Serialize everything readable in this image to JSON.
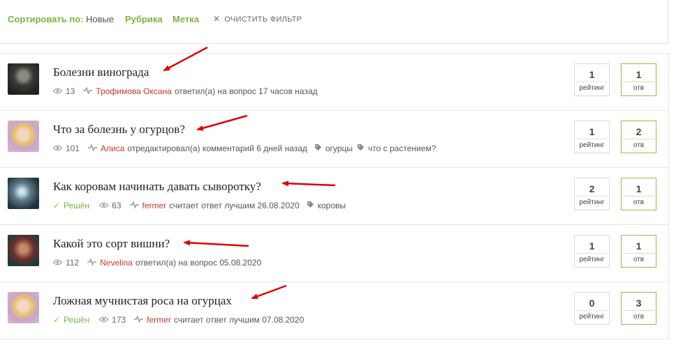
{
  "filter": {
    "sort_label": "Сортировать по:",
    "sort_value": "Новые",
    "category": "Рубрика",
    "tag": "Метка",
    "clear": "ОЧИСТИТЬ ФИЛЬТР"
  },
  "questions": [
    {
      "title": "Болезни винограда",
      "solved": "",
      "views": "13",
      "user": "Трофимова Оксана",
      "action": "ответил(а) на вопрос 17 часов назад",
      "tags": [],
      "rating": "1",
      "rating_label": "рейтинг",
      "answers": "1",
      "answers_label": "отв"
    },
    {
      "title": "Что за болезнь у огурцов?",
      "solved": "",
      "views": "101",
      "user": "Алиса",
      "action": "отредактировал(а) комментарий 6 дней назад",
      "tags": [
        "огурцы",
        "что с растением?"
      ],
      "rating": "1",
      "rating_label": "рейтинг",
      "answers": "2",
      "answers_label": "отв"
    },
    {
      "title": "Как коровам начинать давать сыворотку?",
      "solved": "Решён",
      "views": "63",
      "user": "fermer",
      "action": "считает ответ лучшим 26.08.2020",
      "tags": [
        "коровы"
      ],
      "rating": "2",
      "rating_label": "рейтинг",
      "answers": "1",
      "answers_label": "отв"
    },
    {
      "title": "Какой это сорт вишни?",
      "solved": "",
      "views": "112",
      "user": "Nevelina",
      "action": "ответил(а) на вопрос 05.08.2020",
      "tags": [],
      "rating": "1",
      "rating_label": "рейтинг",
      "answers": "1",
      "answers_label": "отв"
    },
    {
      "title": "Ложная мучнистая роса на огурцах",
      "solved": "Решён",
      "views": "173",
      "user": "fermer",
      "action": "считает ответ лучшим 07.08.2020",
      "tags": [],
      "rating": "0",
      "rating_label": "рейтинг",
      "answers": "3",
      "answers_label": "отв"
    }
  ],
  "colors": {
    "accent_green": "#7cb342",
    "user_red": "#c0392b",
    "arrow_red": "#e00000"
  },
  "icons": {
    "views": "eye-icon",
    "activity": "pulse-icon",
    "tag": "tag-icon",
    "solved": "check-icon",
    "clear": "close-icon"
  }
}
